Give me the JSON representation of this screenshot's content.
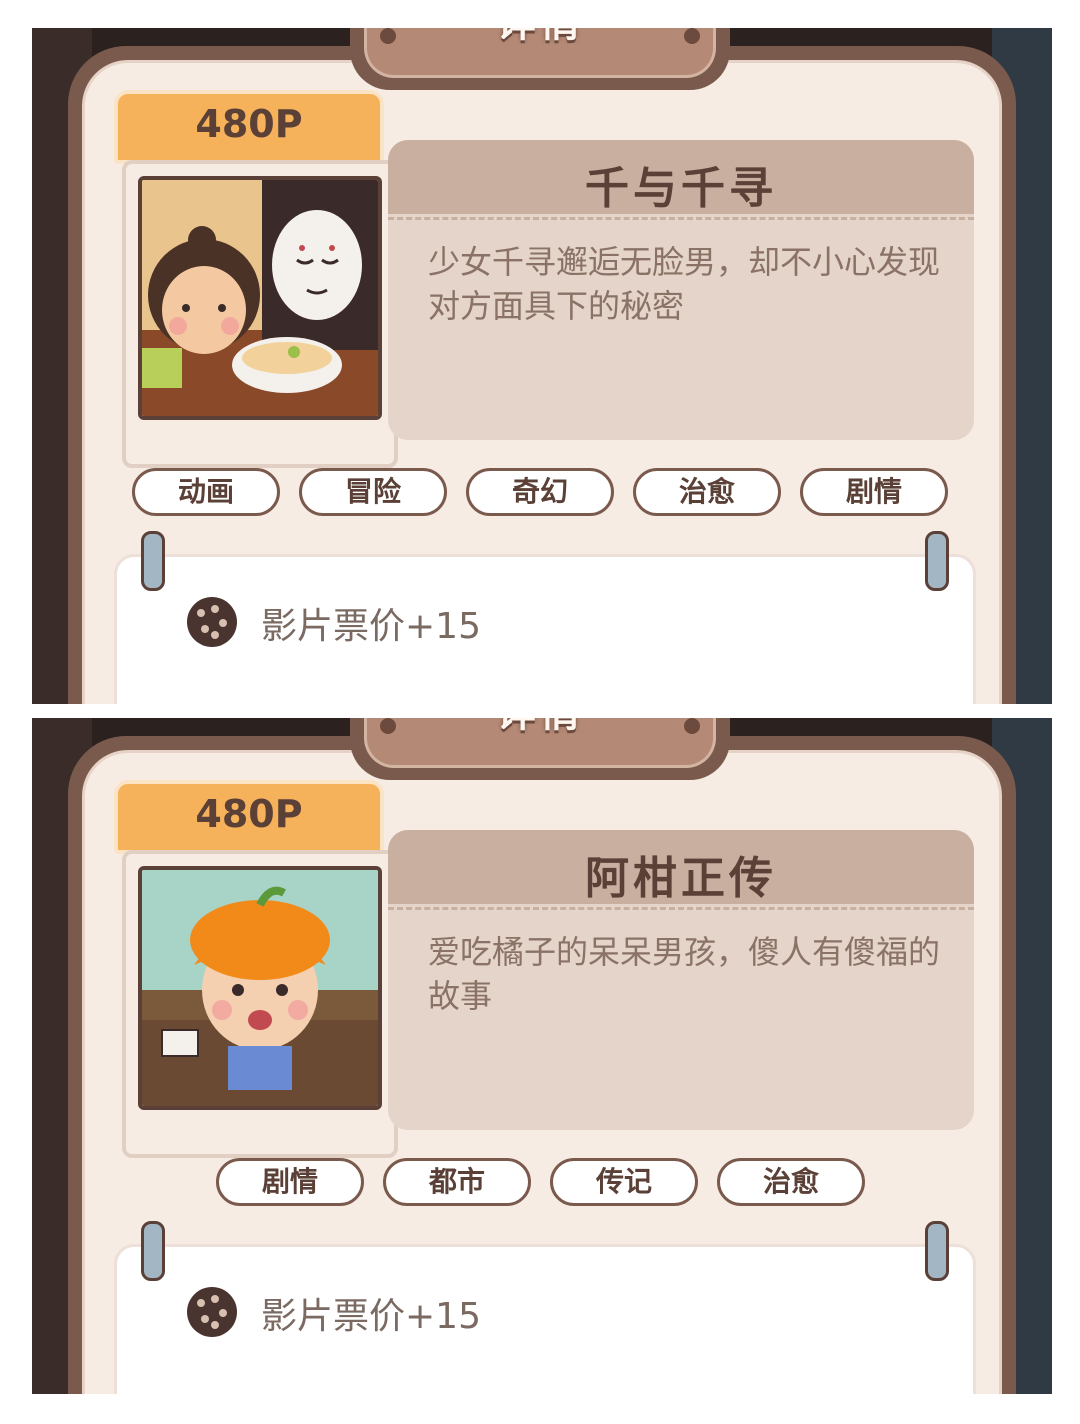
{
  "panels": [
    {
      "header_title": "详情",
      "price": "480P",
      "movie_title": "千与千寻",
      "description": "少女千寻邂逅无脸男，却不小心发现对方面具下的秘密",
      "tags": [
        "动画",
        "冒险",
        "奇幻",
        "治愈",
        "剧情"
      ],
      "bonus": "影片票价+15",
      "poster_icon": "spirited-away-poster"
    },
    {
      "header_title": "详情",
      "price": "480P",
      "movie_title": "阿柑正传",
      "description": "爱吃橘子的呆呆男孩，傻人有傻福的故事",
      "tags": [
        "剧情",
        "都市",
        "传记",
        "治愈"
      ],
      "bonus": "影片票价+15",
      "poster_icon": "orange-boy-poster"
    }
  ]
}
